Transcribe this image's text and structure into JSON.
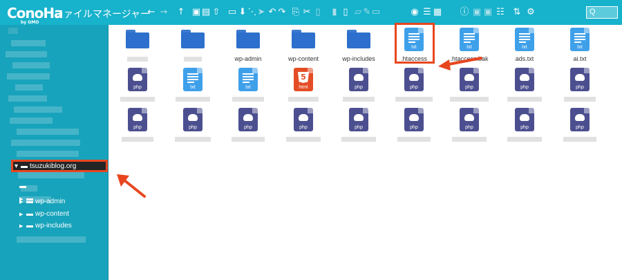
{
  "app": {
    "brand": "ConoHa",
    "brand_sub": "by GMO",
    "title": "ファイルマネージャー",
    "search_label": "Q"
  },
  "toolbar": {
    "icons": [
      "back-icon",
      "forward-icon",
      "up-icon",
      "new-folder-icon",
      "new-file-icon",
      "upload-icon",
      "select-all-icon",
      "download-icon",
      "select-icon",
      "cursor-icon",
      "undo-icon",
      "redo-icon",
      "copy-icon",
      "cut-icon",
      "paste-icon",
      "delete-icon",
      "empty-icon",
      "rename-icon",
      "edit-icon",
      "extract-icon",
      "view-icon",
      "info-icon",
      "list-icon",
      "grid-icon",
      "about-icon",
      "archive-icon",
      "extract-archive-icon",
      "sort-icon",
      "settings-icon"
    ]
  },
  "sidebar": {
    "selected": "tsuzukiblog.org",
    "items": [
      {
        "label": "wp-admin"
      },
      {
        "label": "wp-content"
      },
      {
        "label": "wp-includes"
      }
    ]
  },
  "files": {
    "row1": [
      {
        "type": "folder",
        "label": ""
      },
      {
        "type": "folder",
        "label": ""
      },
      {
        "type": "folder",
        "label": "wp-admin"
      },
      {
        "type": "folder",
        "label": "wp-content"
      },
      {
        "type": "folder",
        "label": "wp-includes"
      },
      {
        "type": "txt",
        "label": ".htaccess",
        "tag": "txt"
      },
      {
        "type": "txt",
        "label": ".htaccess.bak",
        "tag": "txt"
      },
      {
        "type": "txt",
        "label": "ads.txt",
        "tag": "txt"
      },
      {
        "type": "txt",
        "label": "ai.txt",
        "tag": "txt"
      }
    ],
    "row2": [
      {
        "type": "php",
        "tag": "php"
      },
      {
        "type": "txt",
        "tag": "txt"
      },
      {
        "type": "txt",
        "tag": "txt"
      },
      {
        "type": "html",
        "tag": "html"
      },
      {
        "type": "php",
        "tag": "php"
      },
      {
        "type": "php",
        "tag": "php"
      },
      {
        "type": "php",
        "tag": "php"
      },
      {
        "type": "php",
        "tag": "php"
      },
      {
        "type": "php",
        "tag": "php"
      }
    ],
    "row3": [
      {
        "type": "php",
        "tag": "php"
      },
      {
        "type": "php",
        "tag": "php"
      },
      {
        "type": "php",
        "tag": "php"
      },
      {
        "type": "php",
        "tag": "php"
      },
      {
        "type": "php",
        "tag": "php"
      },
      {
        "type": "php",
        "tag": "php"
      },
      {
        "type": "php",
        "tag": "php"
      },
      {
        "type": "php",
        "tag": "php"
      },
      {
        "type": "php",
        "tag": "php"
      }
    ]
  },
  "colors": {
    "accent": "#17b2cc",
    "sidebar": "#17a3bb",
    "folder": "#2c6fcc",
    "txt": "#3fa0ea",
    "php": "#4c4f8f",
    "html": "#e44d26",
    "highlight": "#e8461f"
  }
}
